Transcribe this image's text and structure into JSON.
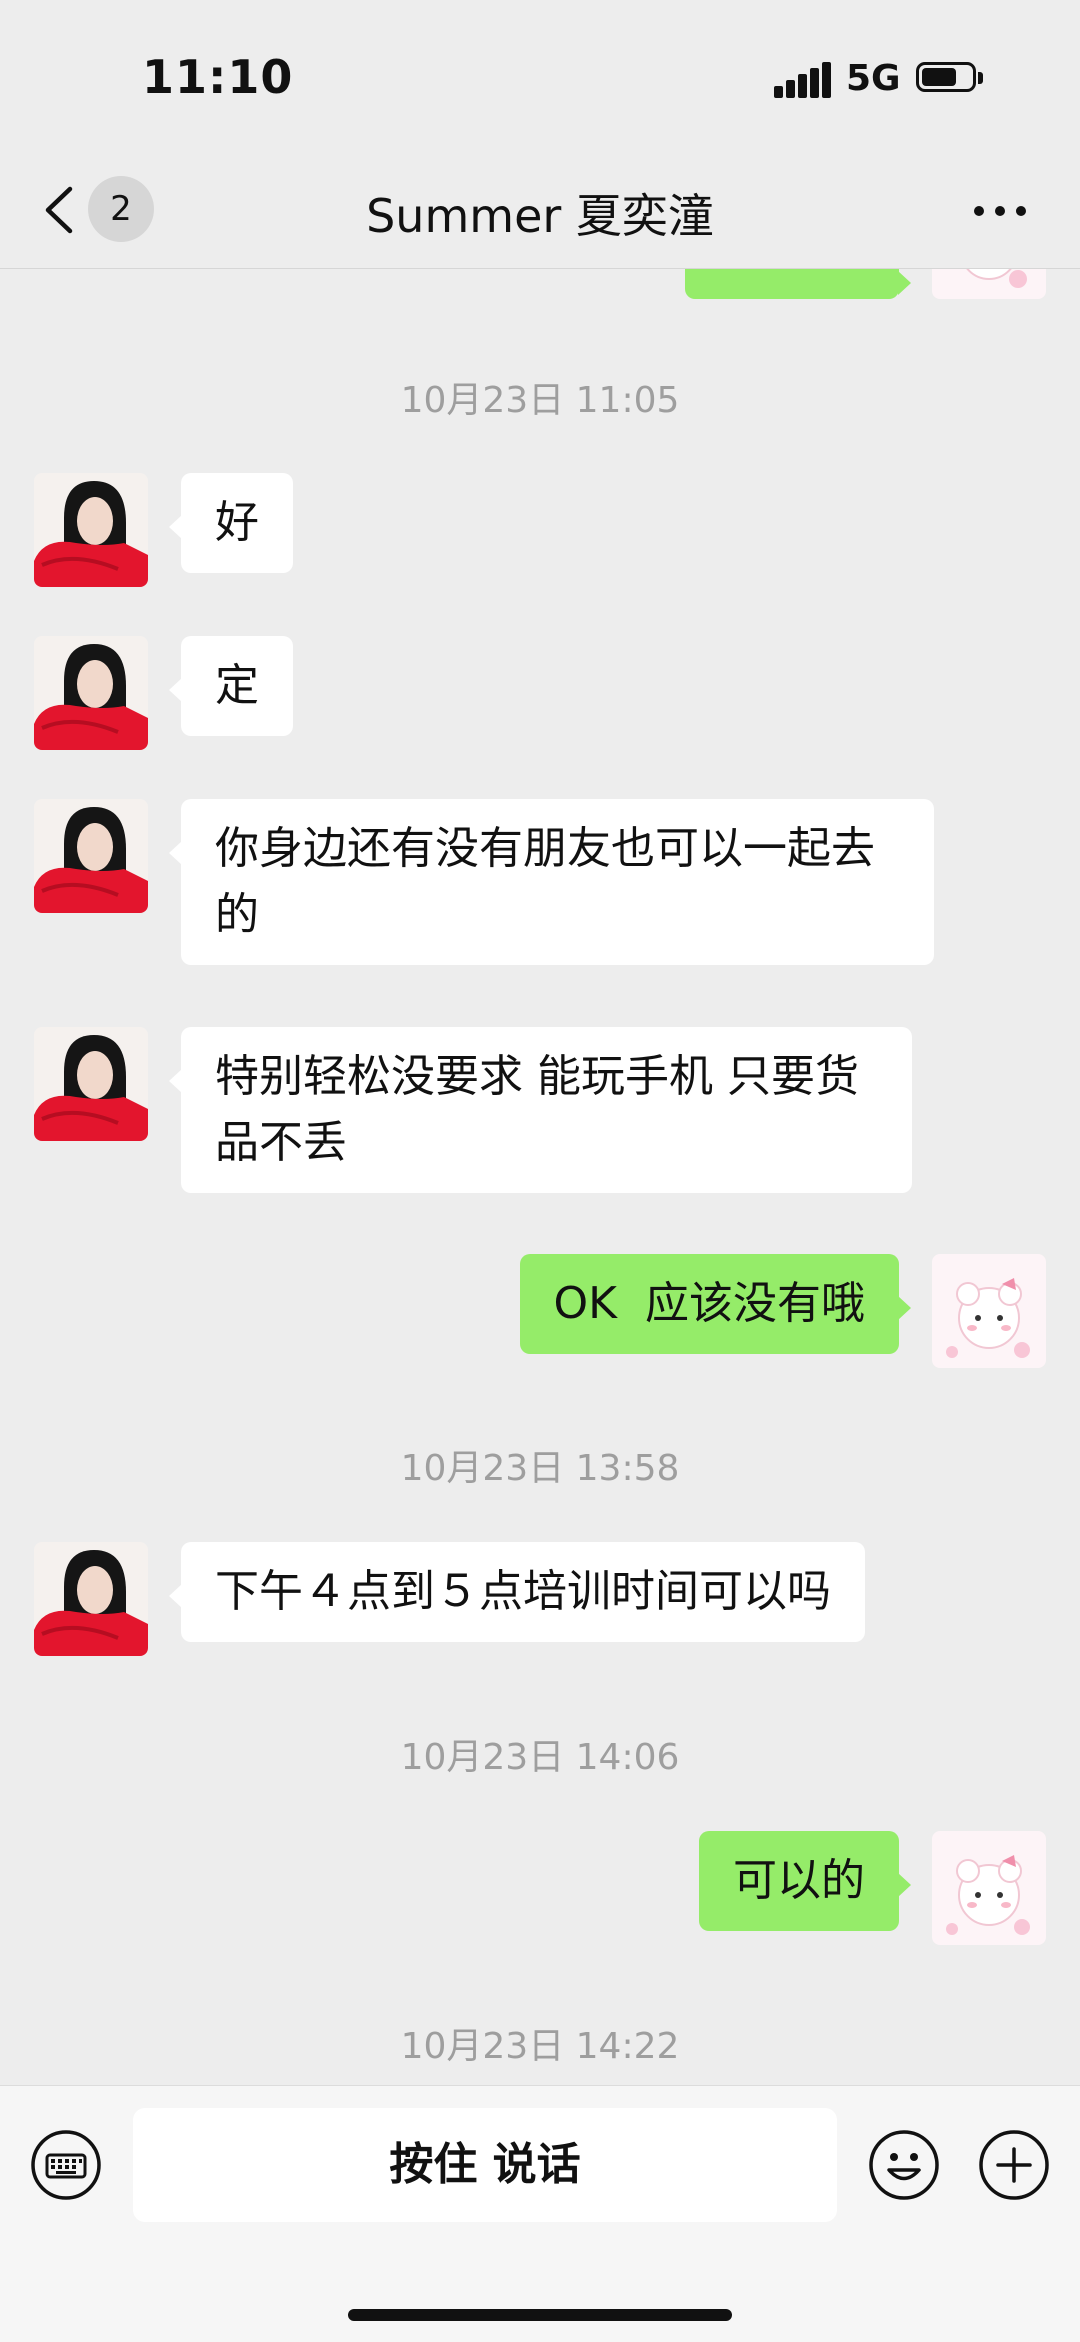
{
  "status_bar": {
    "time": "11:10",
    "network": "5G",
    "signal_icon": "signal-bars-icon",
    "battery_icon": "battery-icon"
  },
  "header": {
    "back_icon": "chevron-left-icon",
    "unread_count": "2",
    "title": "Summer 夏奕潼",
    "more_icon": "more-dots-icon"
  },
  "messages": [
    {
      "type": "timestamp",
      "text": "10月23日 11:05"
    },
    {
      "type": "message",
      "side": "left",
      "text": "好"
    },
    {
      "type": "message",
      "side": "left",
      "text": "定"
    },
    {
      "type": "message",
      "side": "left",
      "text": "你身边还有没有朋友也可以一起去的"
    },
    {
      "type": "message",
      "side": "left",
      "text": "特别轻松没要求 能玩手机 只要货品不丢"
    },
    {
      "type": "message",
      "side": "right",
      "text": "OK  应该没有哦"
    },
    {
      "type": "timestamp",
      "text": "10月23日 13:58"
    },
    {
      "type": "message",
      "side": "left",
      "text": "下午４点到５点培训时间可以吗"
    },
    {
      "type": "timestamp",
      "text": "10月23日 14:06"
    },
    {
      "type": "message",
      "side": "right",
      "text": "可以的"
    },
    {
      "type": "timestamp",
      "text": "10月23日 14:22"
    }
  ],
  "input_bar": {
    "voice_label": "按住 说话",
    "keyboard_icon": "keyboard-icon",
    "emoji_icon": "emoji-icon",
    "plus_icon": "plus-icon"
  },
  "colors": {
    "background": "#ededed",
    "sent_bubble": "#95ec69",
    "received_bubble": "#ffffff",
    "timestamp": "#9e9e9e"
  }
}
